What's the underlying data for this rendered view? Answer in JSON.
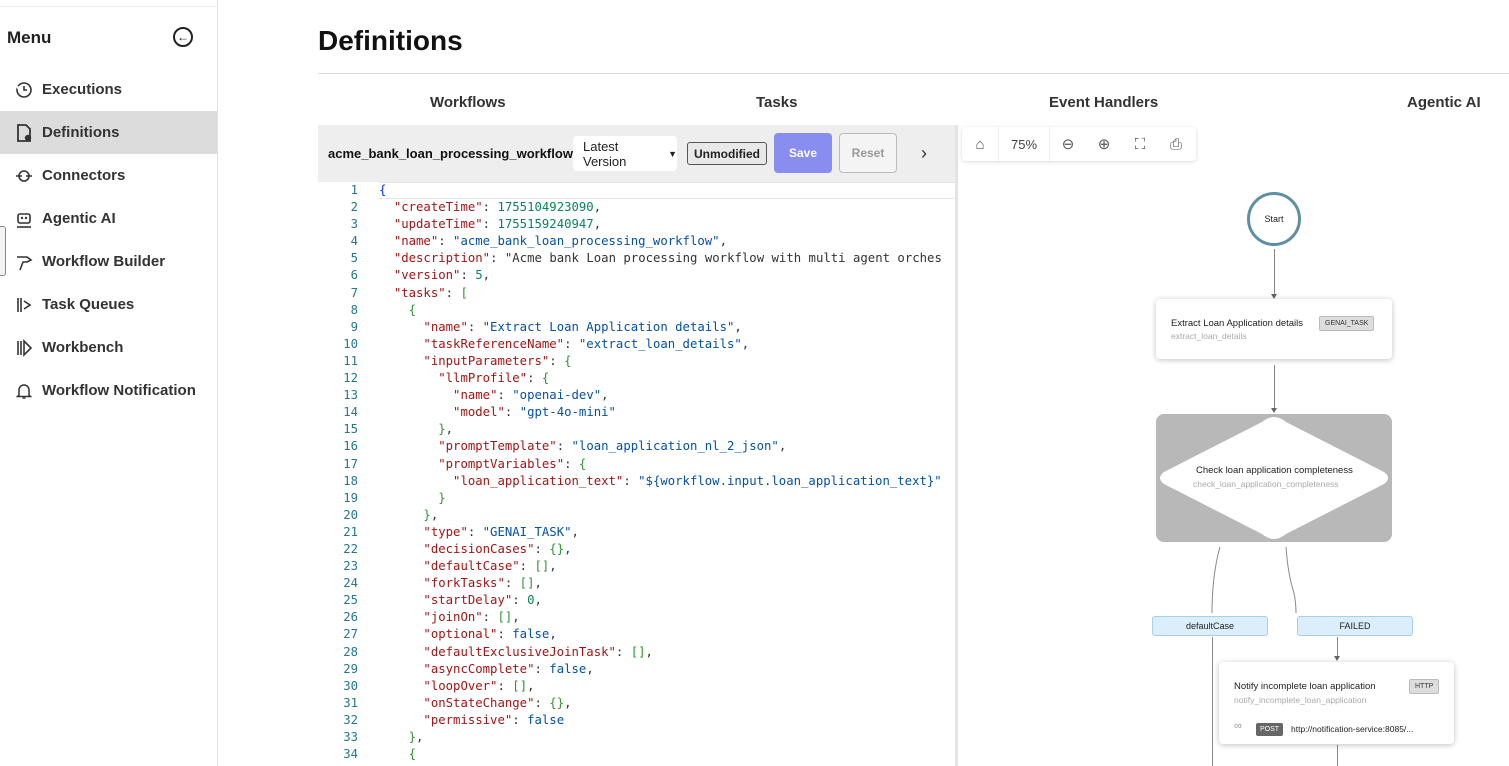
{
  "sidebar": {
    "title": "Menu",
    "items": [
      {
        "label": "Executions",
        "icon": "history-icon"
      },
      {
        "label": "Definitions",
        "icon": "file-gear-icon",
        "active": true
      },
      {
        "label": "Connectors",
        "icon": "connector-icon"
      },
      {
        "label": "Agentic AI",
        "icon": "robot-icon"
      },
      {
        "label": "Workflow Builder",
        "icon": "builder-icon"
      },
      {
        "label": "Task Queues",
        "icon": "queue-icon"
      },
      {
        "label": "Workbench",
        "icon": "workbench-icon"
      },
      {
        "label": "Workflow Notification",
        "icon": "bell-icon"
      }
    ]
  },
  "page": {
    "title": "Definitions"
  },
  "tabs": [
    "Workflows",
    "Tasks",
    "Event Handlers",
    "Agentic AI"
  ],
  "editor": {
    "workflow_name": "acme_bank_loan_processing_workflow",
    "version_select": "Latest Version",
    "status_badge": "Unmodified",
    "save_label": "Save",
    "reset_label": "Reset",
    "next_glyph": "›"
  },
  "code_lines": [
    "{",
    "  \"createTime\": 1755104923090,",
    "  \"updateTime\": 1755159240947,",
    "  \"name\": \"acme_bank_loan_processing_workflow\",",
    "  \"description\": \"Acme bank Loan processing workflow with multi agent orches",
    "  \"version\": 5,",
    "  \"tasks\": [",
    "    {",
    "      \"name\": \"Extract Loan Application details\",",
    "      \"taskReferenceName\": \"extract_loan_details\",",
    "      \"inputParameters\": {",
    "        \"llmProfile\": {",
    "          \"name\": \"openai-dev\",",
    "          \"model\": \"gpt-4o-mini\"",
    "        },",
    "        \"promptTemplate\": \"loan_application_nl_2_json\",",
    "        \"promptVariables\": {",
    "          \"loan_application_text\": \"${workflow.input.loan_application_text}\"",
    "        }",
    "      },",
    "      \"type\": \"GENAI_TASK\",",
    "      \"decisionCases\": {},",
    "      \"defaultCase\": [],",
    "      \"forkTasks\": [],",
    "      \"startDelay\": 0,",
    "      \"joinOn\": [],",
    "      \"optional\": false,",
    "      \"defaultExclusiveJoinTask\": [],",
    "      \"asyncComplete\": false,",
    "      \"loopOver\": [],",
    "      \"onStateChange\": {},",
    "      \"permissive\": false",
    "    },",
    "    {"
  ],
  "graph": {
    "zoom": "75%",
    "start_label": "Start",
    "task1": {
      "title": "Extract Loan Application details",
      "ref": "extract_loan_details",
      "type": "GENAI_TASK"
    },
    "decision": {
      "title": "Check loan application completeness",
      "ref": "check_loan_application_completeness"
    },
    "cases": [
      "defaultCase",
      "FAILED"
    ],
    "task2": {
      "title": "Notify incomplete loan application",
      "ref": "notify_incomplete_loan_application",
      "type": "HTTP",
      "method": "POST",
      "url": "http://notification-service:8085/..."
    }
  }
}
